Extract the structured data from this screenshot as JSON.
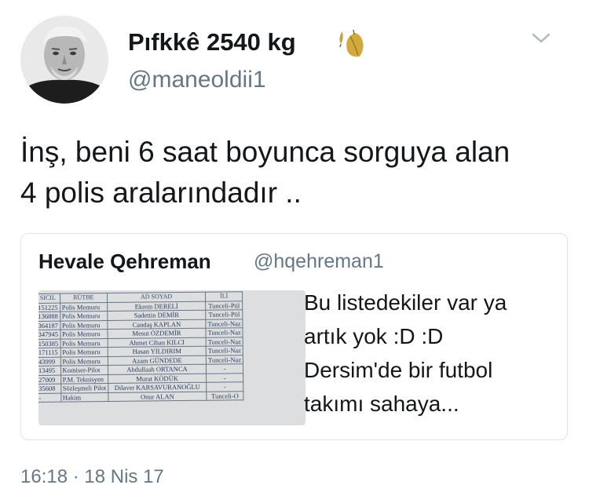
{
  "tweet": {
    "author_name": "Pıfkkê 2540 kg",
    "author_handle": "@maneoldii1",
    "name_emoji_icon": "leaves-icon",
    "menu_icon": "chevron-down-icon",
    "text_lines": [
      "İnş, beni 6 saat boyunca sorguya alan",
      "4 polis aralarındadır .."
    ],
    "timestamp": "16:18 · 18 Nis 17"
  },
  "quoted_tweet": {
    "author_name": "Hevale Qehreman",
    "author_handle": "@hqehreman1",
    "text_lines": [
      "Bu listedekiler var ya",
      "artık yok :D :D",
      "Dersim'de bir futbol",
      "takımı sahaya..."
    ],
    "media_table": {
      "headers": [
        "SICIL",
        "RÜTBE",
        "AD SOYAD",
        "İLİ"
      ],
      "rows": [
        [
          "151225",
          "Polis Memuru",
          "Ekrem DERELİ",
          "Tunceli-Pül"
        ],
        [
          "136888",
          "Polis Memuru",
          "Sadettin DEMİR",
          "Tunceli-Pül"
        ],
        [
          "364187",
          "Polis Memuru",
          "Candaş KAPLAN",
          "Tunceli-Naz"
        ],
        [
          "347945",
          "Polis Memuru",
          "Mesut ÖZDEMİR",
          "Tunceli-Naz"
        ],
        [
          "150385",
          "Polis Memuru",
          "Ahmet Cihan KILCI",
          "Tunceli-Naz"
        ],
        [
          "171115",
          "Polis Memuru",
          "Hasan YILDIRIM",
          "Tunceli-Naz"
        ],
        [
          "43999",
          "Polis Memuru",
          "Azam GÜNDEDE",
          "Tunceli-Naz"
        ],
        [
          "13495",
          "Komiser-Pilot",
          "Abdullaah ORTANCA",
          "-"
        ],
        [
          "27009",
          "P.M. Teknisyen",
          "Murat KÖDÜK",
          "-"
        ],
        [
          "35608",
          "Sözleşmeli Pilot",
          "Dilaver KARSAVURANOĞLU",
          "-"
        ],
        [
          "-",
          "Hakim",
          "Onur ALAN",
          "Tunceli-O"
        ]
      ]
    }
  },
  "colors": {
    "text_primary": "#14171a",
    "text_secondary": "#657786",
    "card_border": "#dfe4e8"
  }
}
